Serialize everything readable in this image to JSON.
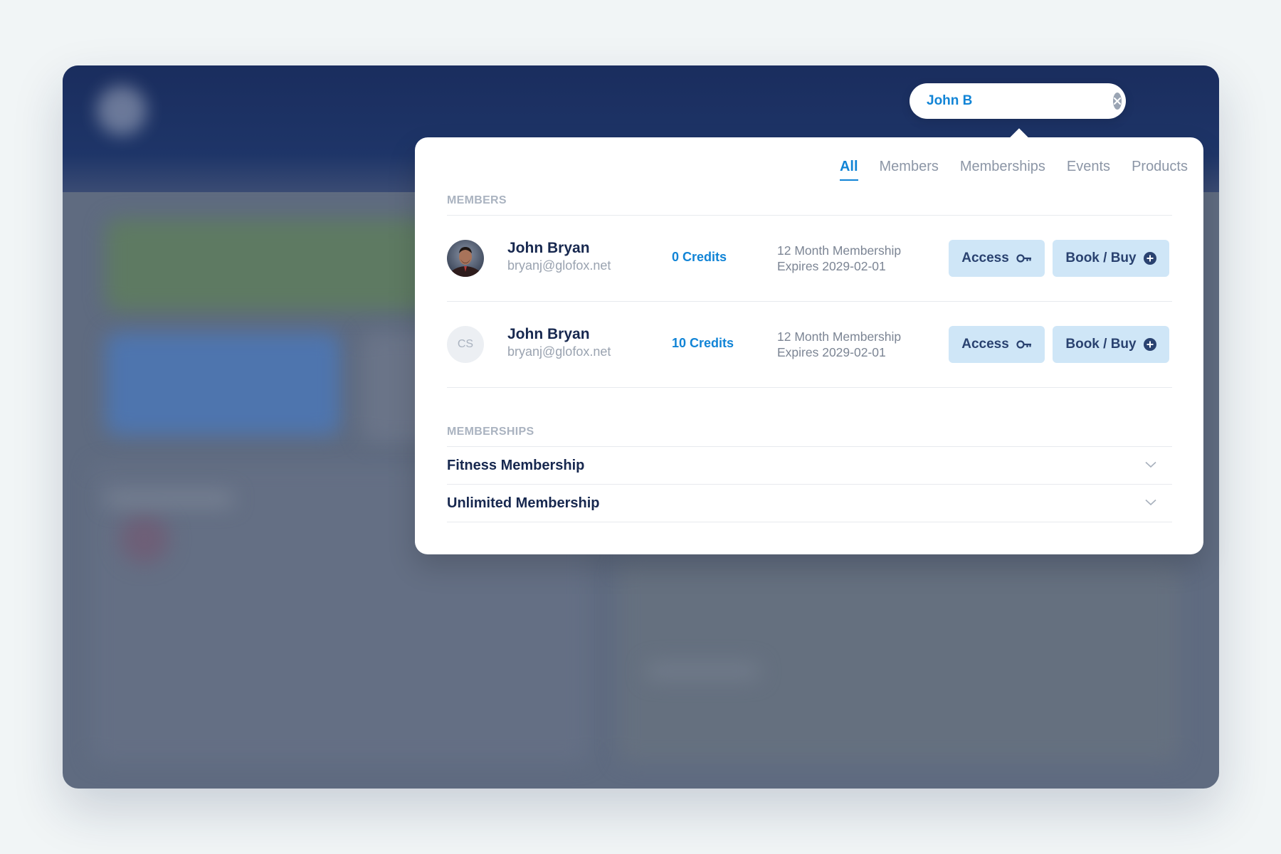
{
  "search": {
    "value": "John B"
  },
  "tabs": [
    {
      "label": "All",
      "active": true
    },
    {
      "label": "Members",
      "active": false
    },
    {
      "label": "Memberships",
      "active": false
    },
    {
      "label": "Events",
      "active": false
    },
    {
      "label": "Products",
      "active": false
    }
  ],
  "members": {
    "section_title": "MEMBERS",
    "items": [
      {
        "name": "John Bryan",
        "email": "bryanj@glofox.net",
        "credits": "0 Credits",
        "plan": "12 Month Membership",
        "expires": "Expires 2029-02-01",
        "avatar": "photo",
        "access_label": "Access",
        "book_label": "Book / Buy"
      },
      {
        "name": "John Bryan",
        "email": "bryanj@glofox.net",
        "credits": "10 Credits",
        "plan": "12 Month Membership",
        "expires": "Expires 2029-02-01",
        "avatar_initials": "CS",
        "access_label": "Access",
        "book_label": "Book / Buy"
      }
    ]
  },
  "memberships": {
    "section_title": "MEMBERSHIPS",
    "items": [
      {
        "name": "Fitness Membership"
      },
      {
        "name": "Unlimited Membership"
      }
    ]
  },
  "icons": {
    "clear": "close-circle-icon",
    "access": "key-icon",
    "book": "plus-circle-icon",
    "expand": "chevron-down-icon"
  },
  "colors": {
    "accent": "#1184d6",
    "header": "#1a2d5e",
    "button_bg": "#cfe6f7",
    "text_dark": "#17284f"
  }
}
